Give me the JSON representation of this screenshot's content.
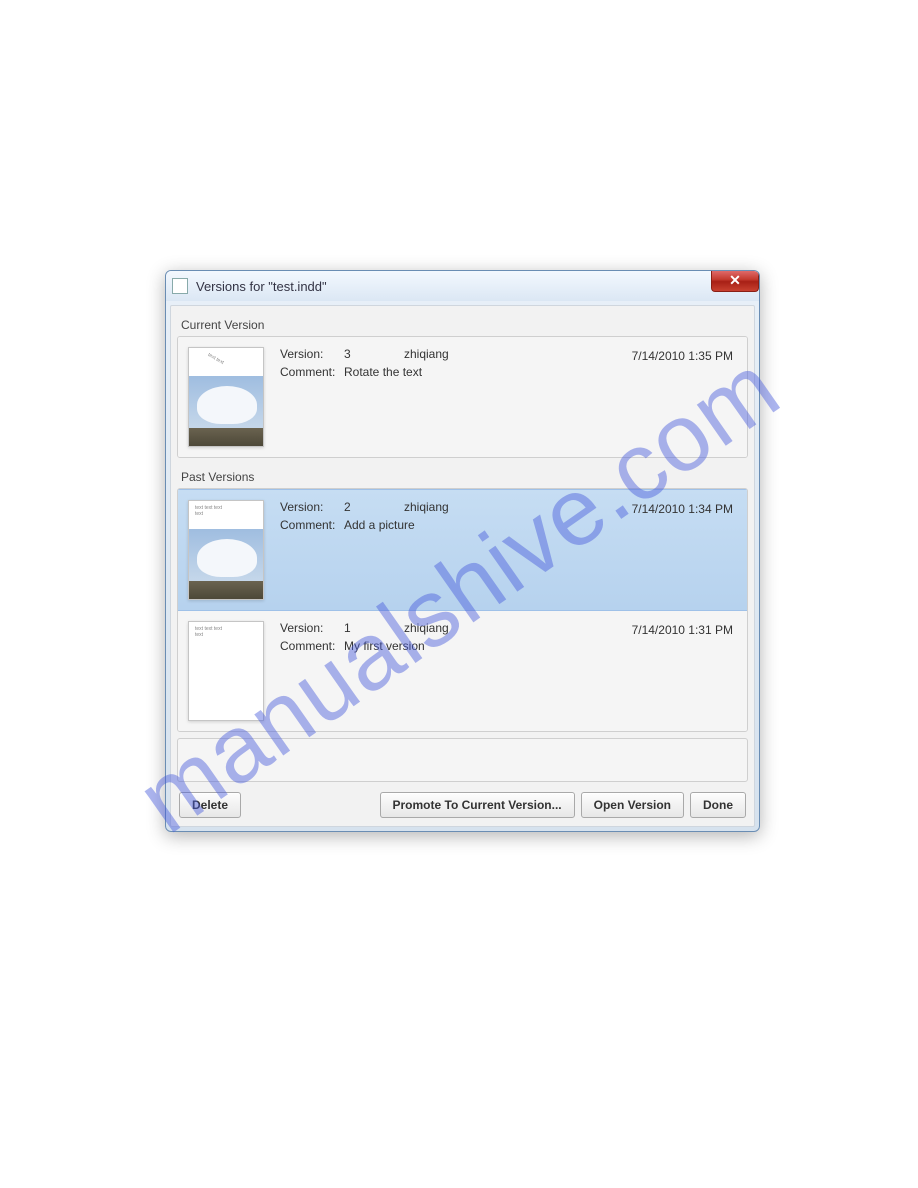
{
  "window": {
    "title": "Versions for \"test.indd\""
  },
  "sections": {
    "current_label": "Current Version",
    "past_label": "Past Versions"
  },
  "labels": {
    "version": "Version:",
    "comment": "Comment:"
  },
  "current": {
    "version": "3",
    "user": "zhiqiang",
    "timestamp": "7/14/2010 1:35 PM",
    "comment": "Rotate the text"
  },
  "past": [
    {
      "version": "2",
      "user": "zhiqiang",
      "timestamp": "7/14/2010 1:34 PM",
      "comment": "Add a picture",
      "selected": true,
      "has_image": true
    },
    {
      "version": "1",
      "user": "zhiqiang",
      "timestamp": "7/14/2010 1:31 PM",
      "comment": "My first version",
      "selected": false,
      "has_image": false
    }
  ],
  "buttons": {
    "delete": "Delete",
    "promote": "Promote To Current Version...",
    "open": "Open Version",
    "done": "Done"
  }
}
